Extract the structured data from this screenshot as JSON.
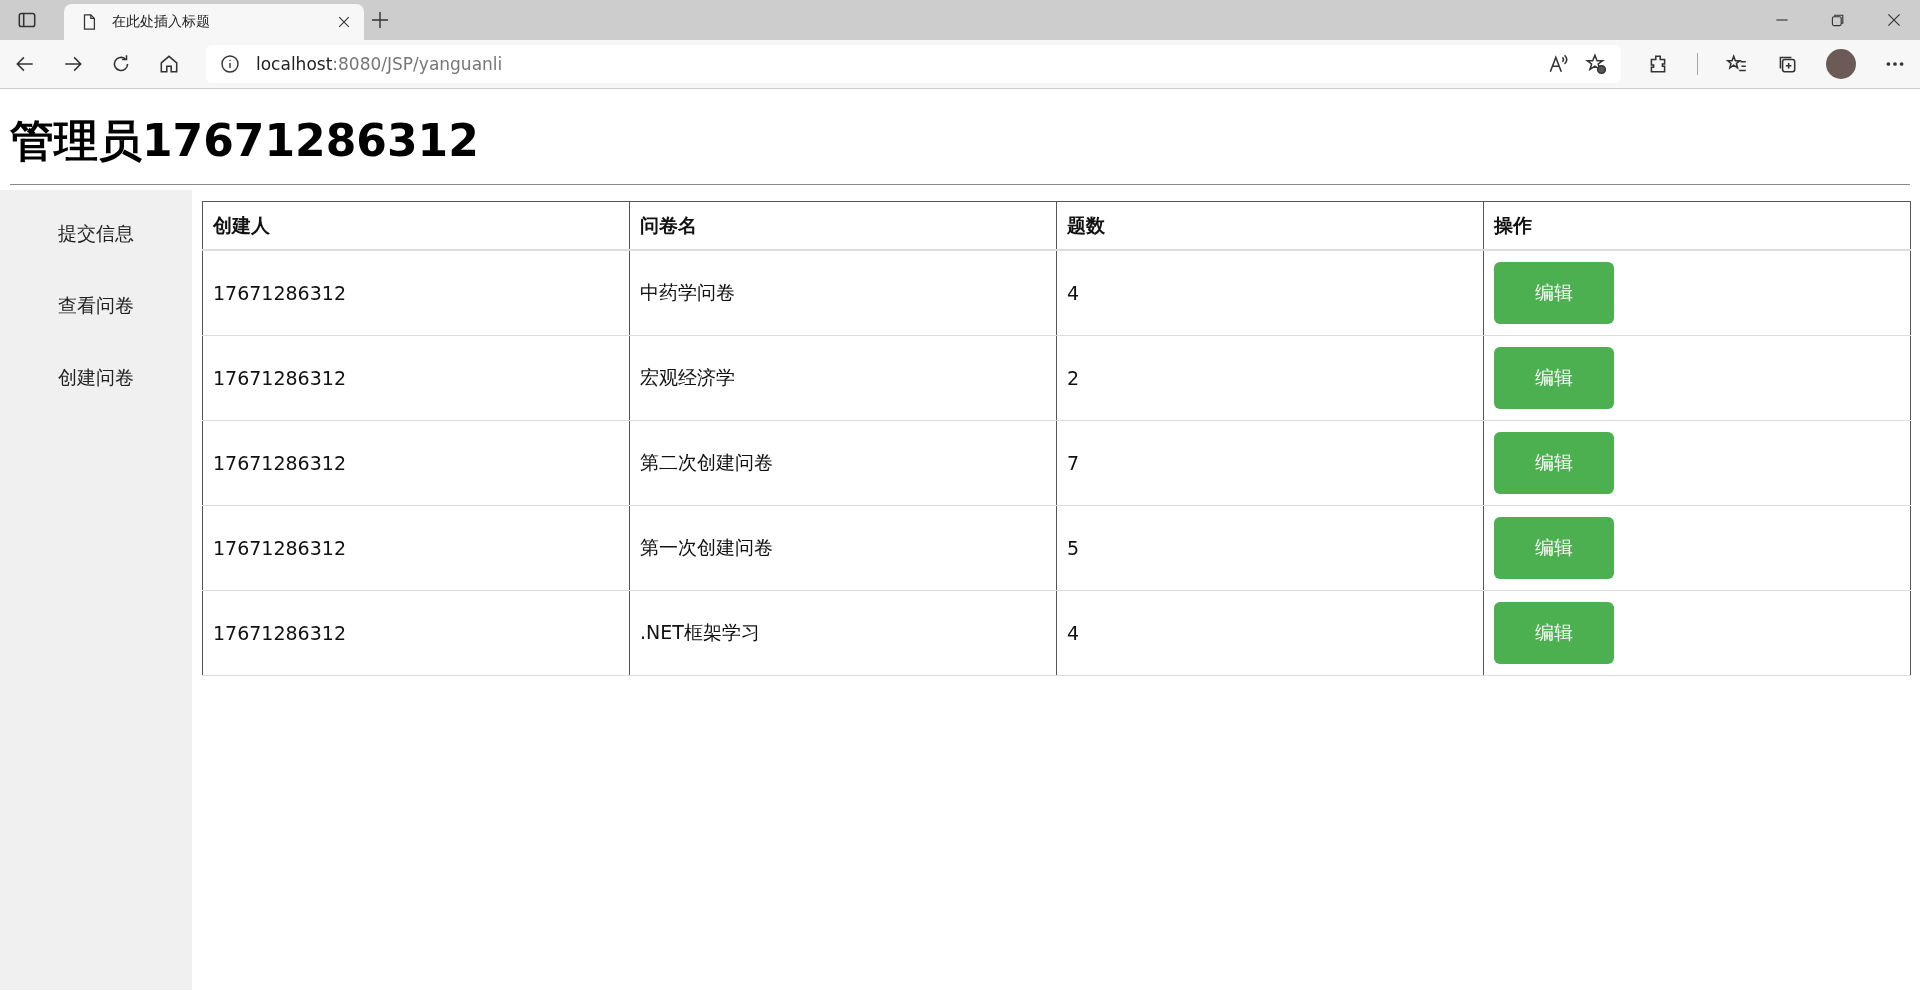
{
  "browser": {
    "tab": {
      "title": "在此处插入标题",
      "selected": true
    },
    "address": {
      "host": "localhost",
      "path": ":8080/JSP/yanguanli"
    }
  },
  "heading": "管理员17671286312",
  "sidebar": {
    "items": [
      {
        "label": "提交信息"
      },
      {
        "label": "查看问卷"
      },
      {
        "label": "创建问卷"
      }
    ]
  },
  "table": {
    "columns": [
      "创建人",
      "问卷名",
      "题数",
      "操作"
    ],
    "rows": [
      {
        "creator": "17671286312",
        "name": "中药学问卷",
        "count": "4",
        "action": "编辑"
      },
      {
        "creator": "17671286312",
        "name": "宏观经济学",
        "count": "2",
        "action": "编辑"
      },
      {
        "creator": "17671286312",
        "name": "第二次创建问卷",
        "count": "7",
        "action": "编辑"
      },
      {
        "creator": "17671286312",
        "name": "第一次创建问卷",
        "count": "5",
        "action": "编辑"
      },
      {
        "creator": "17671286312",
        "name": ".NET框架学习",
        "count": "4",
        "action": "编辑"
      }
    ]
  }
}
